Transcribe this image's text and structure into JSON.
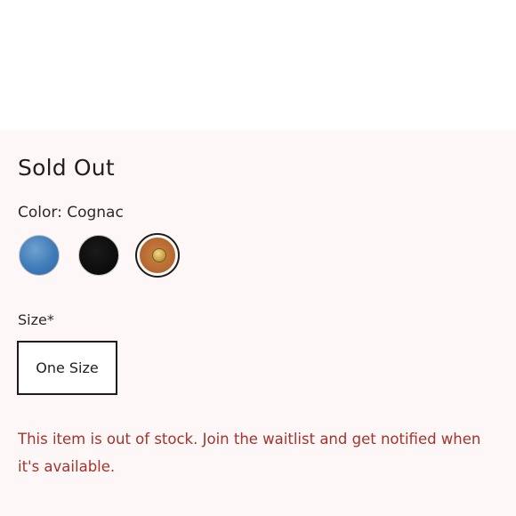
{
  "product": {
    "status": "Sold Out",
    "color_label": "Color: Cognac",
    "colors": [
      {
        "name": "Blue",
        "hex": "#3f7bb8",
        "selected": false
      },
      {
        "name": "Black",
        "hex": "#050505",
        "selected": false
      },
      {
        "name": "Cognac",
        "hex": "#b96b32",
        "selected": true
      }
    ],
    "size_label": "Size*",
    "sizes": [
      {
        "label": "One Size",
        "selected": true
      }
    ],
    "out_of_stock_message": "This item is out of stock. Join the waitlist and get notified when it's available."
  },
  "theme": {
    "panel_background": "#fdf8f7",
    "error_text": "#a8322a",
    "text": "#1f1f1f"
  }
}
